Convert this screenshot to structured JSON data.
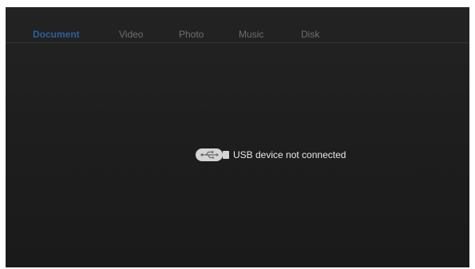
{
  "tabs": [
    {
      "label": "Document",
      "active": true
    },
    {
      "label": "Video",
      "active": false
    },
    {
      "label": "Photo",
      "active": false
    },
    {
      "label": "Music",
      "active": false
    },
    {
      "label": "Disk",
      "active": false
    }
  ],
  "status": {
    "icon": "usb-icon",
    "message": "USB device not connected"
  },
  "colors": {
    "background": "#1e1e1e",
    "active_tab": "#2e5f9e",
    "inactive_tab": "#6f6f6f",
    "text": "#e8e8e8",
    "divider": "#343434"
  }
}
